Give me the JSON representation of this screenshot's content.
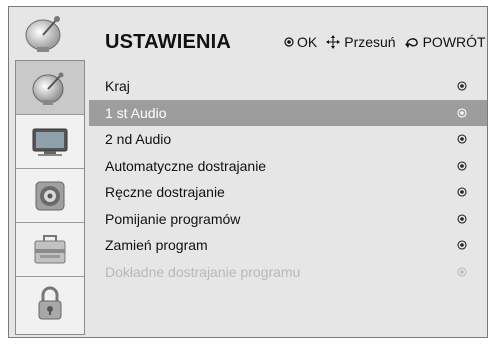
{
  "header": {
    "title": "USTAWIENIA",
    "hint_ok_label": "OK",
    "hint_move_label": "Przesuń",
    "hint_back_label": "POWRÓT"
  },
  "sidebar": {
    "items": [
      {
        "icon": "satellite-dish-icon",
        "active": true
      },
      {
        "icon": "tv-monitor-icon",
        "active": false
      },
      {
        "icon": "speaker-icon",
        "active": false
      },
      {
        "icon": "toolbox-icon",
        "active": false
      },
      {
        "icon": "padlock-icon",
        "active": false
      }
    ]
  },
  "menu": {
    "items": [
      {
        "label": "Kraj",
        "state": "normal"
      },
      {
        "label": "1 st Audio",
        "state": "selected"
      },
      {
        "label": "2 nd Audio",
        "state": "normal"
      },
      {
        "label": "Automatyczne dostrajanie",
        "state": "normal"
      },
      {
        "label": "Ręczne dostrajanie",
        "state": "normal"
      },
      {
        "label": "Pomijanie programów",
        "state": "normal"
      },
      {
        "label": "Zamień program",
        "state": "normal"
      },
      {
        "label": "Dokładne dostrajanie programu",
        "state": "disabled"
      }
    ]
  }
}
